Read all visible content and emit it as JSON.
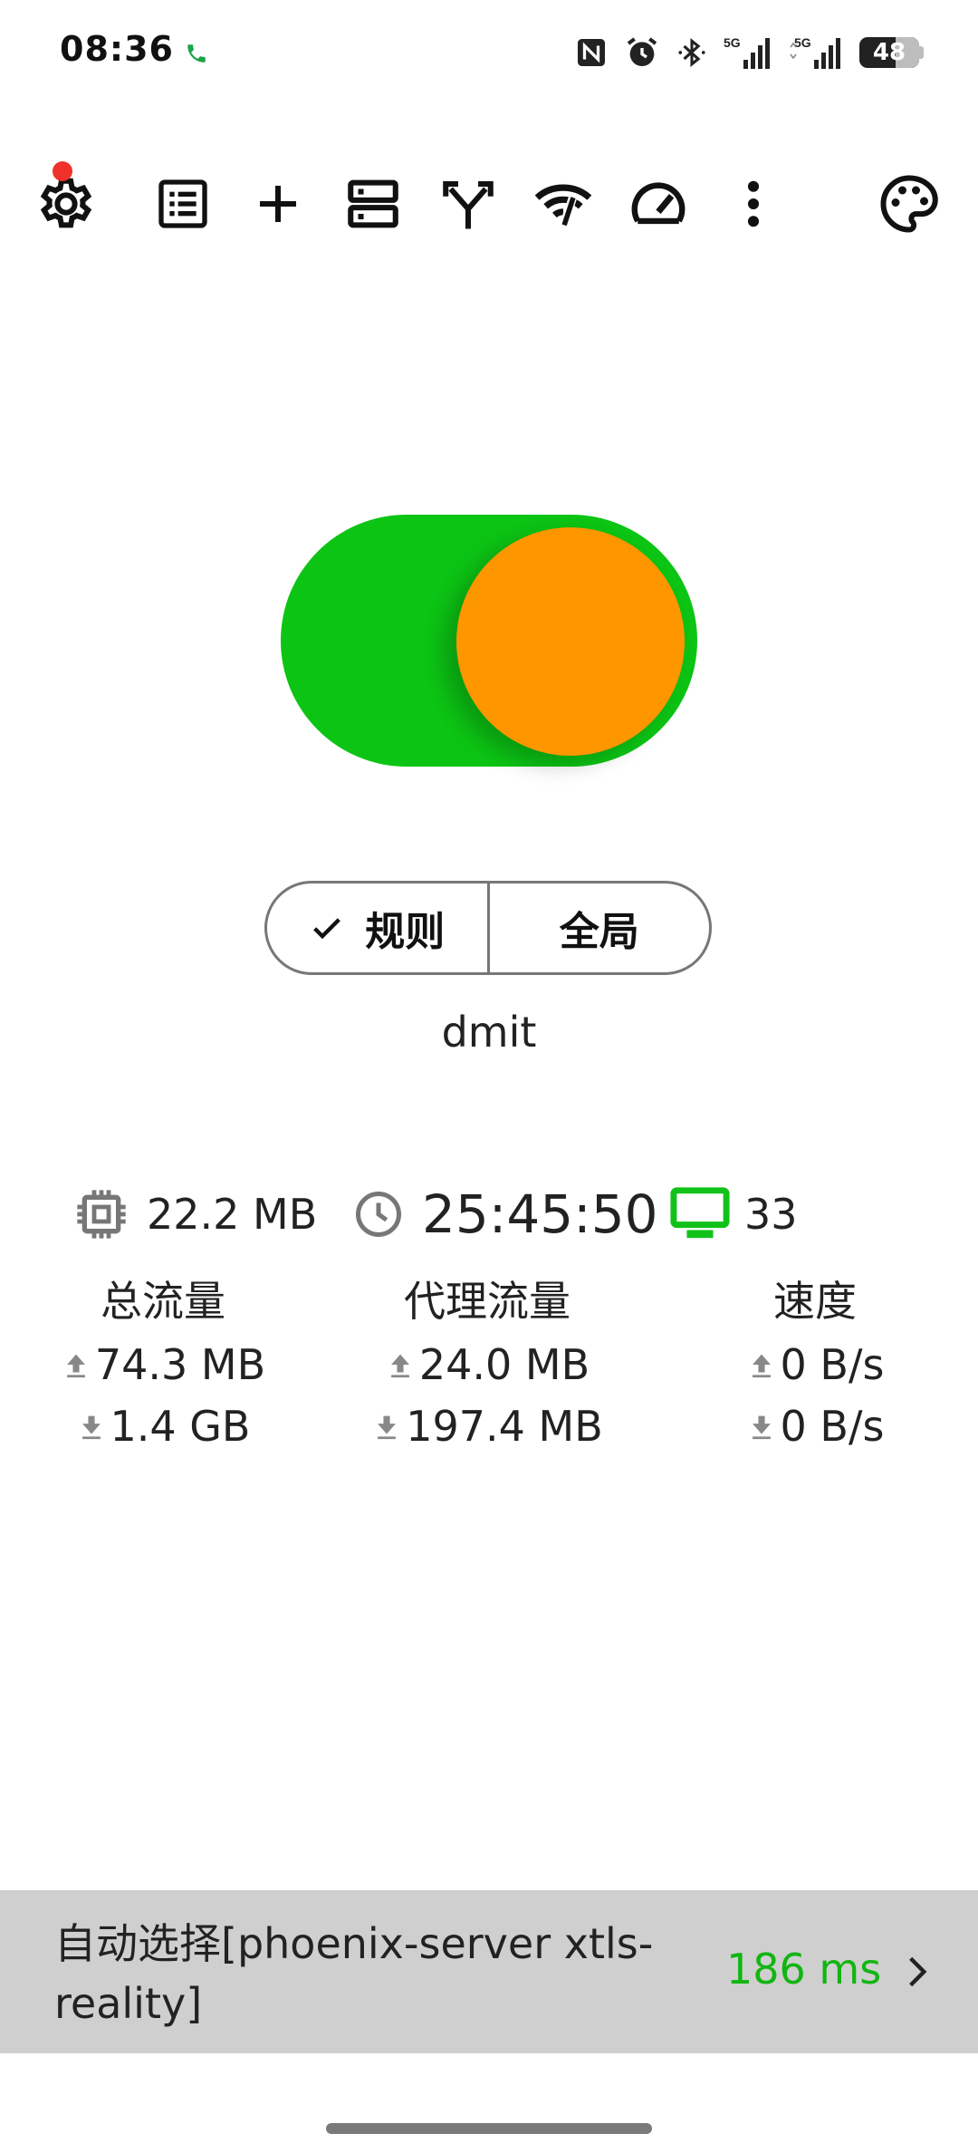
{
  "status_bar": {
    "time": "08:36",
    "battery": "48",
    "network_1": "5G",
    "network_2": "5G",
    "icons": [
      "call-active-icon",
      "nfc-icon",
      "alarm-icon",
      "bluetooth-icon",
      "signal-icon",
      "signal-icon",
      "battery-icon"
    ]
  },
  "toolbar": {
    "icons": [
      "settings-icon",
      "list-icon",
      "add-icon",
      "servers-icon",
      "route-fork-icon",
      "wifi-off-icon",
      "speedometer-icon",
      "more-vert-icon",
      "palette-icon"
    ],
    "badge_color": "#f0302a"
  },
  "toggle": {
    "state": "on",
    "track_color": "#0cc414",
    "knob_color": "#fe9600"
  },
  "mode": {
    "rule_label": "规则",
    "global_label": "全局",
    "selected": "规则"
  },
  "profile": {
    "name": "dmit"
  },
  "stats": {
    "memory": "22.2 MB",
    "uptime": "25:45:50",
    "connections": "33"
  },
  "traffic": {
    "total": {
      "title": "总流量",
      "up": "74.3 MB",
      "down": "1.4 GB"
    },
    "proxy": {
      "title": "代理流量",
      "up": "24.0 MB",
      "down": "197.4 MB"
    },
    "speed": {
      "title": "速度",
      "up": "0 B/s",
      "down": "0 B/s"
    }
  },
  "proxy_bar": {
    "name": "自动选择[phoenix-server xtls-reality]",
    "latency": "186 ms",
    "latency_color": "#12b512"
  }
}
